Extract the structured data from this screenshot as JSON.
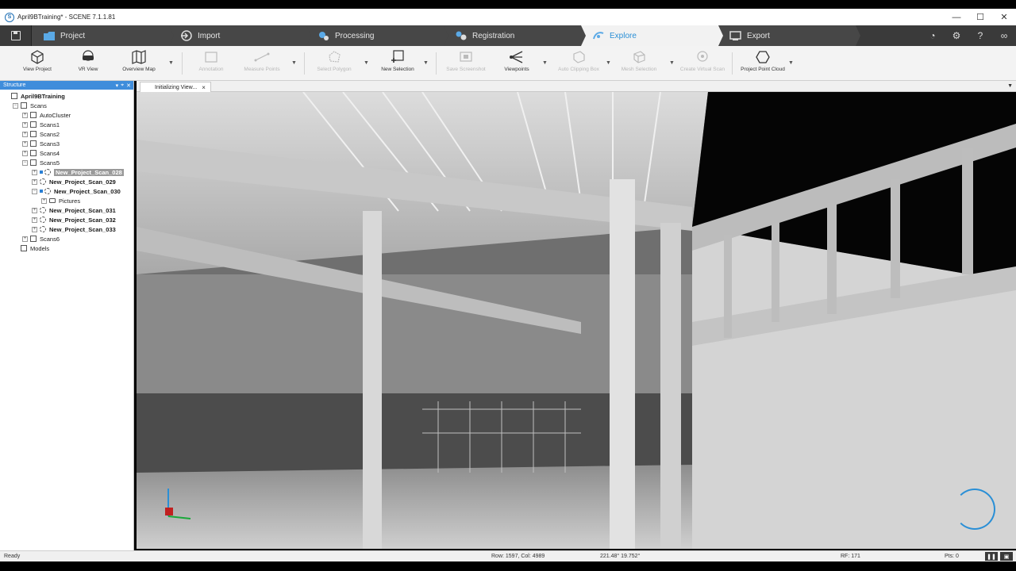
{
  "window": {
    "title": "April9BTraining* - SCENE 7.1.1.81",
    "logo_letter": "S",
    "minimize": "—",
    "maximize": "☐",
    "close": "✕"
  },
  "ribbon": {
    "tabs": [
      {
        "label": "Project",
        "icon": "folder-icon"
      },
      {
        "label": "Import",
        "icon": "import-icon"
      },
      {
        "label": "Processing",
        "icon": "gears-icon"
      },
      {
        "label": "Registration",
        "icon": "registration-icon"
      },
      {
        "label": "Explore",
        "icon": "explore-icon",
        "active": true
      },
      {
        "label": "Export",
        "icon": "export-icon"
      }
    ],
    "right_icons": [
      "update-icon",
      "settings-icon",
      "help-icon",
      "glasses-icon"
    ]
  },
  "toolbar": {
    "buttons": [
      {
        "label": "View Project",
        "icon": "cube-icon",
        "enabled": true
      },
      {
        "label": "VR View",
        "icon": "vr-headset-icon",
        "enabled": true
      },
      {
        "label": "Overview Map",
        "icon": "map-icon",
        "enabled": true
      },
      {
        "label": "Annotation",
        "icon": "annotation-icon",
        "enabled": false
      },
      {
        "label": "Measure Points",
        "icon": "measure-icon",
        "enabled": false
      },
      {
        "label": "Select Polygon",
        "icon": "polygon-icon",
        "enabled": false
      },
      {
        "label": "New Selection",
        "icon": "new-selection-icon",
        "enabled": true
      },
      {
        "label": "Save Screenshot",
        "icon": "screenshot-icon",
        "enabled": false
      },
      {
        "label": "Viewpoints",
        "icon": "viewpoints-icon",
        "enabled": true
      },
      {
        "label": "Auto Clipping Box",
        "icon": "clipping-box-icon",
        "enabled": false
      },
      {
        "label": "Mesh Selection",
        "icon": "mesh-icon",
        "enabled": false
      },
      {
        "label": "Create Virtual Scan",
        "icon": "virtual-scan-icon",
        "enabled": false
      },
      {
        "label": "Project Point Cloud",
        "icon": "point-cloud-icon",
        "enabled": true
      }
    ]
  },
  "structure": {
    "title": "Structure",
    "tree": [
      {
        "label": "April9BTraining",
        "level": 0,
        "bold": true,
        "icon": "project-icon",
        "expander": ""
      },
      {
        "label": "Scans",
        "level": 1,
        "icon": "scans-icon",
        "expander": "−"
      },
      {
        "label": "AutoCluster",
        "level": 2,
        "icon": "cluster-icon",
        "expander": "+"
      },
      {
        "label": "Scans1",
        "level": 2,
        "icon": "cluster-icon",
        "expander": "+"
      },
      {
        "label": "Scans2",
        "level": 2,
        "icon": "cluster-icon",
        "expander": "+"
      },
      {
        "label": "Scans3",
        "level": 2,
        "icon": "cluster-icon",
        "expander": "+"
      },
      {
        "label": "Scans4",
        "level": 2,
        "icon": "cluster-icon",
        "expander": "+"
      },
      {
        "label": "Scans5",
        "level": 2,
        "icon": "cluster-icon",
        "expander": "−"
      },
      {
        "label": "New_Project_Scan_028",
        "level": 3,
        "bold": true,
        "selected": true,
        "icon": "scan-icon",
        "expander": "+"
      },
      {
        "label": "New_Project_Scan_029",
        "level": 3,
        "bold": true,
        "icon": "scan-icon",
        "expander": "+"
      },
      {
        "label": "New_Project_Scan_030",
        "level": 3,
        "bold": true,
        "loaded": true,
        "icon": "scan-icon",
        "expander": "−"
      },
      {
        "label": "Pictures",
        "level": 4,
        "icon": "folder-icon",
        "expander": "+"
      },
      {
        "label": "New_Project_Scan_031",
        "level": 3,
        "bold": true,
        "icon": "scan-icon",
        "expander": "+"
      },
      {
        "label": "New_Project_Scan_032",
        "level": 3,
        "bold": true,
        "icon": "scan-icon",
        "expander": "+"
      },
      {
        "label": "New_Project_Scan_033",
        "level": 3,
        "bold": true,
        "icon": "scan-icon",
        "expander": "+"
      },
      {
        "label": "Scans6",
        "level": 2,
        "icon": "cluster-icon",
        "expander": "+"
      },
      {
        "label": "Models",
        "level": 1,
        "icon": "models-icon",
        "expander": ""
      }
    ]
  },
  "viewer": {
    "tab_label": "Initializing View...",
    "close": "×",
    "menu": "▼"
  },
  "status": {
    "ready": "Ready",
    "rowcol": "Row: 1597, Col: 4989",
    "angles": "221.48° 19.752°",
    "rf": "RF: 171",
    "pts": "Pts:  0"
  }
}
